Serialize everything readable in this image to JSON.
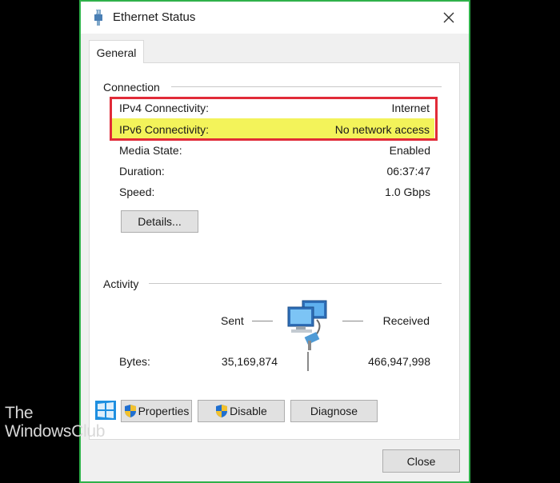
{
  "window": {
    "title": "Ethernet Status",
    "tab_general": "General"
  },
  "connection": {
    "group_label": "Connection",
    "rows": [
      {
        "label": "IPv4 Connectivity:",
        "value": "Internet"
      },
      {
        "label": "IPv6 Connectivity:",
        "value": "No network access"
      },
      {
        "label": "Media State:",
        "value": "Enabled"
      },
      {
        "label": "Duration:",
        "value": "06:37:47"
      },
      {
        "label": "Speed:",
        "value": "1.0 Gbps"
      }
    ],
    "details_button": "Details..."
  },
  "activity": {
    "group_label": "Activity",
    "sent_label": "Sent",
    "received_label": "Received",
    "bytes_label": "Bytes:",
    "bytes_sent": "35,169,874",
    "bytes_received": "466,947,998"
  },
  "buttons": {
    "properties": "Properties",
    "disable": "Disable",
    "diagnose": "Diagnose",
    "close": "Close"
  },
  "watermark": {
    "line1": "The",
    "line2": "WindowsClub"
  },
  "colors": {
    "window_border": "#2fb14a",
    "highlight_box": "#e12b38",
    "highlight_fill": "#f3f35a"
  },
  "icons": {
    "title": "ethernet-cable-icon",
    "close": "close-icon",
    "network": "network-computers-icon",
    "shield": "uac-shield-icon"
  }
}
